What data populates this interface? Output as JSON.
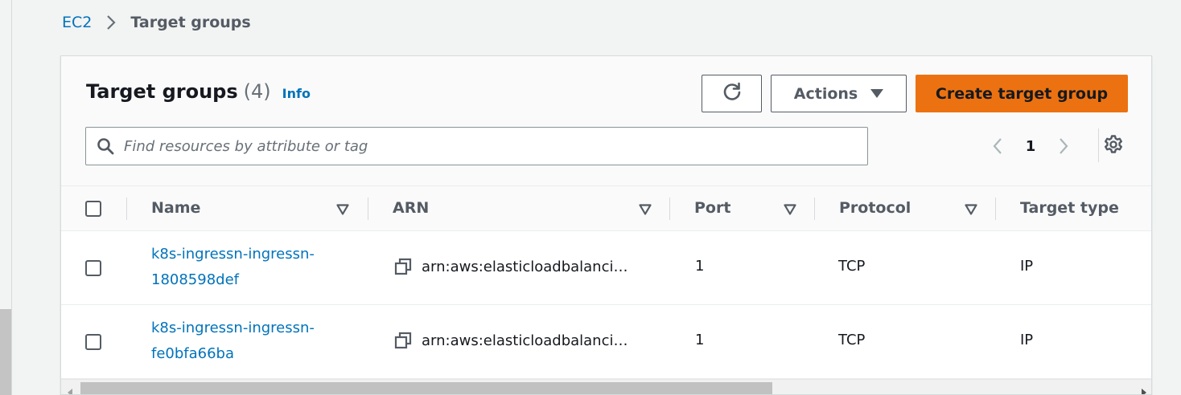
{
  "breadcrumb": {
    "parent": "EC2",
    "current": "Target groups"
  },
  "panel": {
    "title": "Target groups",
    "count": "(4)",
    "info": "Info"
  },
  "toolbar": {
    "refresh_icon": "refresh-icon",
    "actions_label": "Actions",
    "create_label": "Create target group"
  },
  "search": {
    "placeholder": "Find resources by attribute or tag",
    "value": ""
  },
  "pagination": {
    "current_page": "1"
  },
  "table": {
    "columns": [
      {
        "label": "Name"
      },
      {
        "label": "ARN"
      },
      {
        "label": "Port"
      },
      {
        "label": "Protocol"
      },
      {
        "label": "Target type"
      }
    ],
    "rows": [
      {
        "name_line1": "k8s-ingressn-ingressn-",
        "name_line2": "1808598def",
        "arn": "arn:aws:elasticloadbalanci…",
        "port": "1",
        "protocol": "TCP",
        "target_type": "IP"
      },
      {
        "name_line1": "k8s-ingressn-ingressn-",
        "name_line2": "fe0bfa66ba",
        "arn": "arn:aws:elasticloadbalanci…",
        "port": "1",
        "protocol": "TCP",
        "target_type": "IP"
      }
    ]
  },
  "colors": {
    "link": "#0073bb",
    "primary_button": "#ec7211",
    "text": "#16191f",
    "muted_text": "#545b64"
  }
}
